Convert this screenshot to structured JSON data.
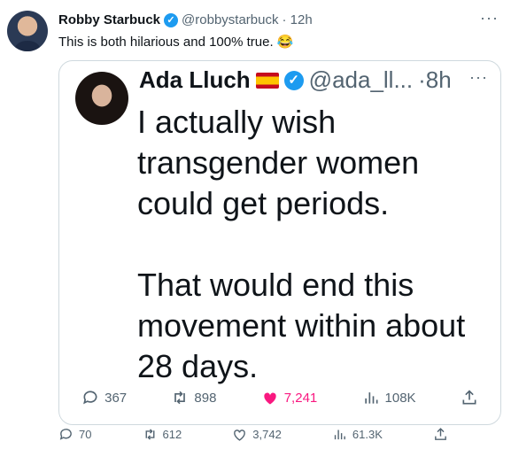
{
  "tweet": {
    "name": "Robby Starbuck",
    "handle": "@robbystarbuck",
    "time": "· 12h",
    "text": "This is both hilarious and 100% true. 😂",
    "actions": {
      "replies": "70",
      "retweets": "612",
      "likes": "3,742",
      "views": "61.3K"
    }
  },
  "embedded": {
    "name": "Ada Lluch",
    "handle": "@ada_ll...",
    "time": "·8h",
    "text": "I actually wish\ntransgender women\ncould get periods.\n\nThat would end this\nmovement within about\n28 days.",
    "actions": {
      "replies": "367",
      "retweets": "898",
      "likes": "7,241",
      "views": "108K"
    }
  },
  "colors": {
    "accent": "#1d9bf0",
    "like": "#f91880",
    "muted": "#536471"
  },
  "icons": [
    "verified-icon",
    "more-icon",
    "reply-icon",
    "retweet-icon",
    "like-icon",
    "views-icon",
    "share-icon",
    "spain-flag-icon"
  ]
}
